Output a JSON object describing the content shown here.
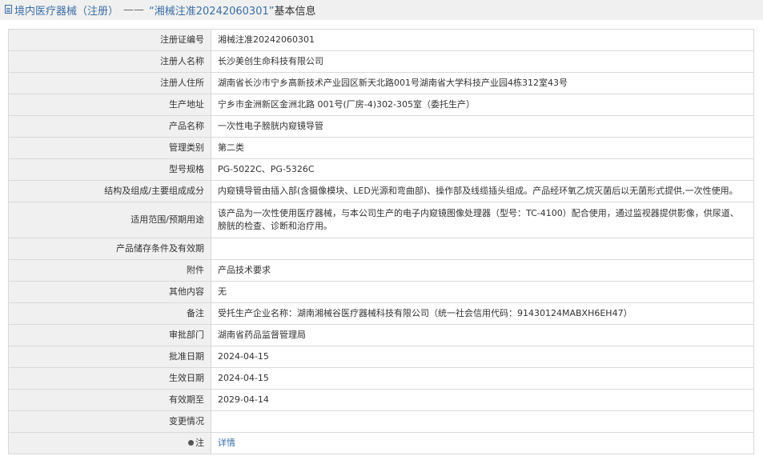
{
  "header": {
    "category": "境内医疗器械（注册）",
    "separator": "——",
    "record_title": "“湘械注准20242060301”",
    "suffix": "基本信息"
  },
  "rows": [
    {
      "label": "注册证编号",
      "value": "湘械注准20242060301"
    },
    {
      "label": "注册人名称",
      "value": "长沙美创生命科技有限公司"
    },
    {
      "label": "注册人住所",
      "value": "湖南省长沙市宁乡高新技术产业园区新天北路001号湖南省大学科技产业园4栋312室43号"
    },
    {
      "label": "生产地址",
      "value": "宁乡市金洲新区金洲北路 001号(厂房-4)302-305室（委托生产）"
    },
    {
      "label": "产品名称",
      "value": "一次性电子膀胱内窥镜导管"
    },
    {
      "label": "管理类别",
      "value": "第二类"
    },
    {
      "label": "型号规格",
      "value": "PG-5022C、PG-5326C"
    },
    {
      "label": "结构及组成/主要组成成分",
      "value": "内窥镜导管由插入部(含摄像模块、LED光源和弯曲部)、操作部及线缆插头组成。产品经环氧乙烷灭菌后以无菌形式提供,一次性使用。"
    },
    {
      "label": "适用范围/预期用途",
      "value": "该产品为一次性使用医疗器械，与本公司生产的电子内窥镜图像处理器（型号：TC-4100）配合使用，通过监视器提供影像，供尿道、膀胱的检查、诊断和治疗用。"
    },
    {
      "label": "产品储存条件及有效期",
      "value": ""
    },
    {
      "label": "附件",
      "value": "产品技术要求"
    },
    {
      "label": "其他内容",
      "value": "无"
    },
    {
      "label": "备注",
      "value": "受托生产企业名称：湖南湘械谷医疗器械科技有限公司（统一社会信用代码：91430124MABXH6EH47）"
    },
    {
      "label": "审批部门",
      "value": "湖南省药品监督管理局"
    },
    {
      "label": "批准日期",
      "value": "2024-04-15"
    },
    {
      "label": "生效日期",
      "value": "2024-04-15"
    },
    {
      "label": "有效期至",
      "value": "2029-04-14"
    },
    {
      "label": "变更情况",
      "value": ""
    }
  ],
  "note_row": {
    "label": "注",
    "link_text": "详情"
  }
}
